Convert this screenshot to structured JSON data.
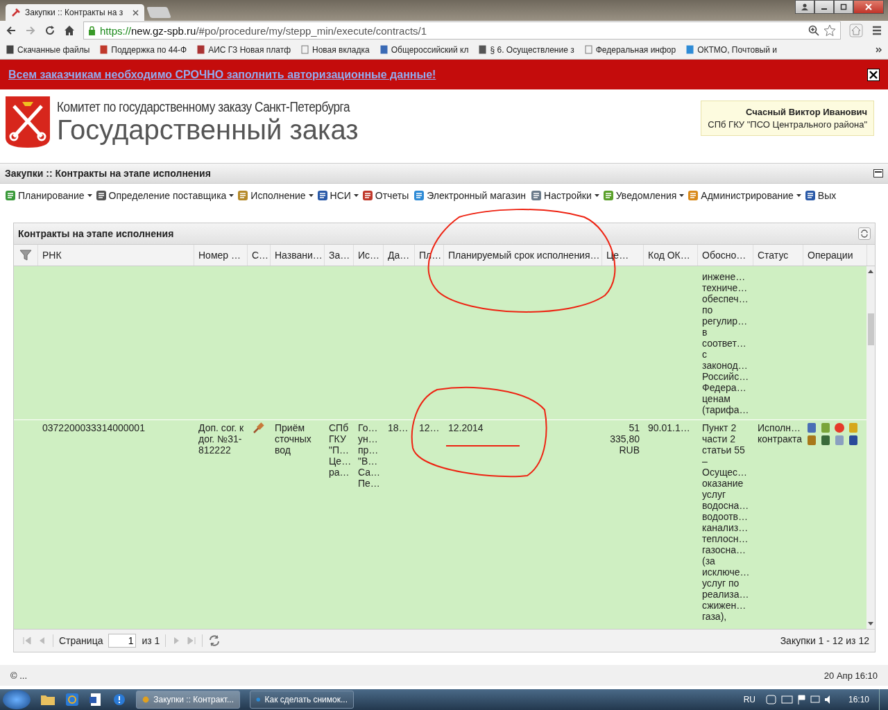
{
  "browser": {
    "tab": {
      "title": "Закупки :: Контракты на з",
      "selected": true
    },
    "address": {
      "scheme": "https://",
      "host": "new.gz-spb.ru",
      "path": "/#po/procedure/my/stepp_min/execute/contracts/1"
    },
    "bookmarks": [
      "Скачанные файлы",
      "Поддержка по 44-Ф",
      "АИС ГЗ Новая платф",
      "Новая вкладка",
      "Общероссийский кл",
      "§ 6. Осуществление з",
      "Федеральная инфор",
      "ОКТМО, Почтовый и"
    ]
  },
  "banner": {
    "text": "Всем заказчикам необходимо СРОЧНО заполнить авторизационные данные!"
  },
  "header": {
    "org": "Комитет по государственному заказу Санкт-Петербурга",
    "title": "Государственный заказ",
    "user": {
      "name": "Счасный Виктор Иванович",
      "unit": "СПб ГКУ \"ПСО Центрального района\""
    }
  },
  "page_title": "Закупки :: Контракты на этапе исполнения",
  "menu": [
    {
      "label": "Планирование",
      "dropdown": true
    },
    {
      "label": "Определение поставщика",
      "dropdown": true
    },
    {
      "label": "Исполнение",
      "dropdown": true
    },
    {
      "label": "НСИ",
      "dropdown": true
    },
    {
      "label": "Отчеты",
      "dropdown": false
    },
    {
      "label": "Электронный магазин",
      "dropdown": false
    },
    {
      "label": "Настройки",
      "dropdown": true
    },
    {
      "label": "Уведомления",
      "dropdown": true
    },
    {
      "label": "Администрирование",
      "dropdown": true
    },
    {
      "label": "Вых",
      "dropdown": false
    }
  ],
  "panel": {
    "title": "Контракты на этапе исполнения",
    "columns": [
      "РНК",
      "Номер …",
      "С…",
      "Названи…",
      "За…",
      "Ис…",
      "Да…",
      "Пл…",
      "Планируемый срок исполнения…",
      "Це…",
      "Код ОК…",
      "Обосно…",
      "Статус",
      "Операции"
    ],
    "rows": [
      {
        "kind": "continued",
        "justification": "инжене…\nтехниче…\nобеспеч…\nпо\nрегулир…\nв\nсоответ…\nс\nзаконод…\nРоссийс…\nФедера…\nценам\n(тарифа…"
      },
      {
        "kind": "record",
        "rnk": "0372200033314000001",
        "number": "Доп. сог. к\nдог. №31-\n812222",
        "name": "Приём\nсточных\nвод",
        "customer": "СПб\nГКУ\n\"П…\nЦе…\nра…",
        "executor": "Го…\nун…\nпр…\n\"В…\nСа…\nПе…",
        "date": "18…",
        "plan": "12…",
        "planned_term": "12.2014",
        "price": "51\n335,80\nRUB",
        "code": "90.01.1…",
        "justification": "Пункт 2\nчасти 2\nстатьи 55\n–\nОсущес…\nоказание\nуслуг\nводосна…\nводоотв…\nканализ…\nтеплосн…\nгазосна…\n(за\nисключе…\nуслуг по\nреализа…\nсжижен…\nгаза),",
        "status": "Исполн…\nконтракта"
      }
    ],
    "pager": {
      "page_label": "Страница",
      "page": "1",
      "of": "из 1",
      "summary": "Закупки 1 - 12 из 12"
    }
  },
  "footer": {
    "copyright": "© ...",
    "datetime": "20 Апр 16:10"
  },
  "taskbar": {
    "tasks": [
      {
        "label": "Закупки :: Контракт...",
        "selected": true
      },
      {
        "label": "Как сделать снимок...",
        "selected": false
      }
    ],
    "language": "RU",
    "time": "16:10"
  }
}
